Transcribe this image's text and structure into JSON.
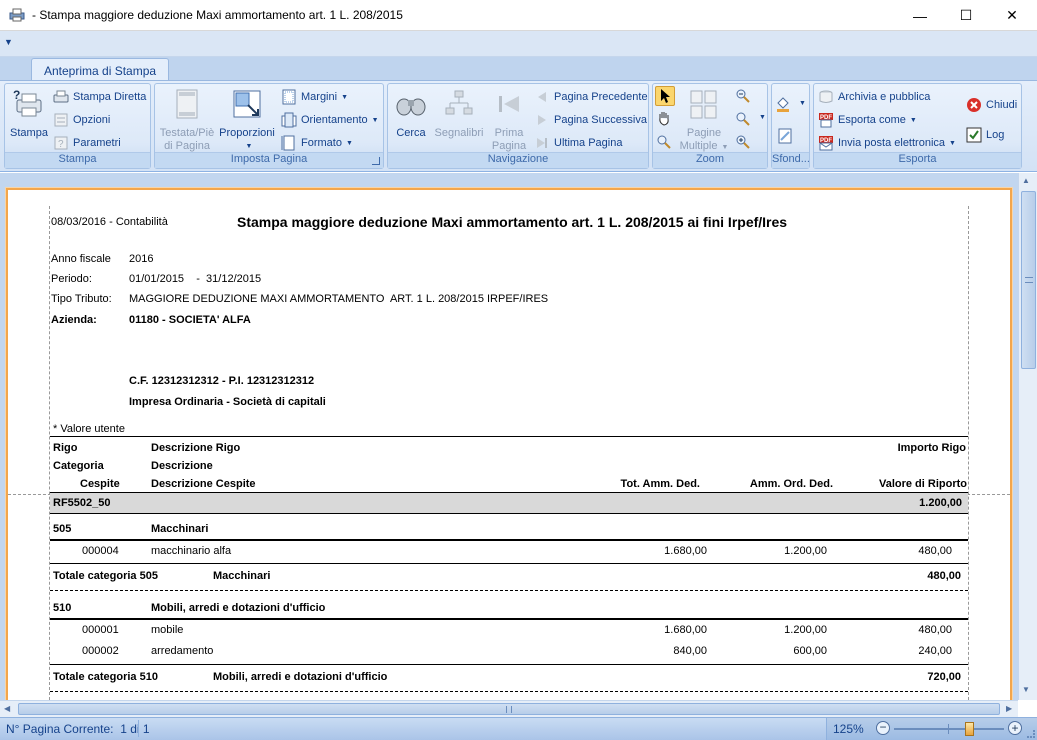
{
  "window": {
    "title": "-  Stampa maggiore deduzione Maxi ammortamento art. 1 L. 208/2015",
    "minimize": "—",
    "maximize": "☐",
    "close": "✕"
  },
  "ribbon": {
    "tab": "Anteprima di Stampa",
    "groups": {
      "stampa": {
        "label": "Stampa",
        "stampa": "Stampa",
        "stampa_diretta": "Stampa Diretta",
        "opzioni": "Opzioni",
        "parametri": "Parametri"
      },
      "imposta": {
        "label": "Imposta Pagina",
        "testata_1": "Testata/Piè",
        "testata_2": "di Pagina",
        "proporzioni": "Proporzioni",
        "margini": "Margini",
        "orientamento": "Orientamento",
        "formato": "Formato"
      },
      "navigazione": {
        "label": "Navigazione",
        "cerca": "Cerca",
        "segnalibri": "Segnalibri",
        "prima_1": "Prima",
        "prima_2": "Pagina",
        "precedente": "Pagina Precedente",
        "successiva": "Pagina Successiva",
        "ultima": "Ultima Pagina"
      },
      "zoom": {
        "label": "Zoom",
        "pagine_1": "Pagine",
        "pagine_2": "Multiple"
      },
      "sfondo": {
        "label": "Sfond..."
      },
      "esporta": {
        "label": "Esporta",
        "archivia": "Archivia e pubblica",
        "esporta_come": "Esporta come",
        "invia": "Invia posta elettronica",
        "chiudi": "Chiudi",
        "log": "Log"
      }
    }
  },
  "report": {
    "header_left": "08/03/2016 - Contabilità",
    "title": "Stampa maggiore deduzione Maxi ammortamento art. 1 L. 208/2015 ai fini Irpef/Ires",
    "anno_label": "Anno fiscale",
    "anno_value": "2016",
    "periodo_label": "Periodo:",
    "periodo_value": "01/01/2015    -  31/12/2015",
    "tributo_label": "Tipo Tributo:",
    "tributo_value": "MAGGIORE DEDUZIONE MAXI AMMORTAMENTO  ART. 1 L. 208/2015 IRPEF/IRES",
    "azienda_label": "Azienda:",
    "azienda_value": "01180 - SOCIETA' ALFA",
    "cf": "C.F. 12312312312 - P.I. 12312312312",
    "impresa": "Impresa Ordinaria - Società di capitali",
    "valore_utente": "* Valore utente",
    "col": {
      "rigo": "Rigo",
      "descrizione_rigo": "Descrizione Rigo",
      "importo_rigo": "Importo Rigo",
      "categoria": "Categoria",
      "descrizione": "Descrizione",
      "cespite": "Cespite",
      "descrizione_cespite": "Descrizione Cespite",
      "tot_amm": "Tot. Amm. Ded.",
      "amm_ord": "Amm. Ord. Ded.",
      "valore_riporto": "Valore di Riporto"
    },
    "rigo_code": "RF5502_50",
    "rigo_value": "1.200,00",
    "cat1": {
      "code": "505",
      "desc": "Macchinari",
      "items": [
        {
          "cespite": "000004",
          "desc": "macchinario alfa",
          "tot": "1.680,00",
          "ord": "1.200,00",
          "val": "480,00"
        }
      ],
      "total_label": "Totale categoria 505",
      "total_desc": "Macchinari",
      "total_value": "480,00"
    },
    "cat2": {
      "code": "510",
      "desc": "Mobili, arredi e dotazioni d'ufficio",
      "items": [
        {
          "cespite": "000001",
          "desc": "mobile",
          "tot": "1.680,00",
          "ord": "1.200,00",
          "val": "480,00"
        },
        {
          "cespite": "000002",
          "desc": "arredamento",
          "tot": "840,00",
          "ord": "600,00",
          "val": "240,00"
        }
      ],
      "total_label": "Totale categoria 510",
      "total_desc": "Mobili, arredi e dotazioni d'ufficio",
      "total_value": "720,00"
    }
  },
  "status": {
    "page": "N° Pagina Corrente:  1 di 1",
    "zoom": "125%",
    "zoom_level_percent": 68
  }
}
